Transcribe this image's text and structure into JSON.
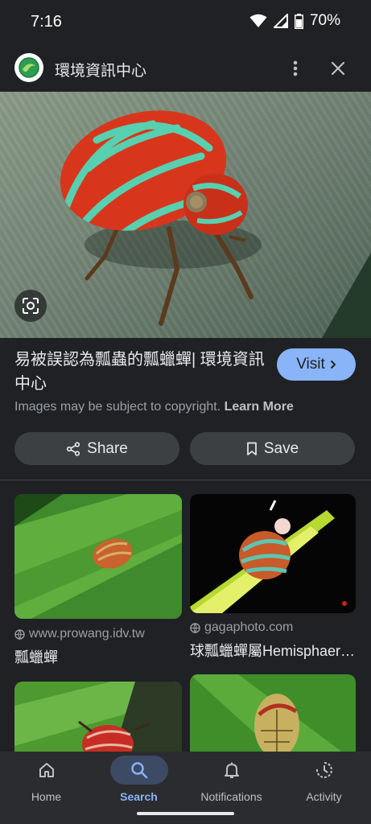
{
  "status_bar": {
    "time": "7:16",
    "battery": "70%"
  },
  "header": {
    "site_name": "環境資訊中心",
    "icons": [
      "more-vert-icon",
      "close-icon"
    ]
  },
  "result": {
    "title": "易被誤認為瓢蟲的瓢蠟蟬| 環境資訊中心",
    "visit_label": "Visit",
    "copyright_text": "Images may be subject to copyright.",
    "learn_more_label": "Learn More",
    "share_label": "Share",
    "save_label": "Save"
  },
  "related": [
    {
      "source": "www.prowang.idv.tw",
      "title": "瓢蠟蟬"
    },
    {
      "source": "gagaphoto.com",
      "title": "球瓢蠟蟬屬Hemisphaerius"
    },
    {
      "source": "",
      "title": ""
    },
    {
      "source": "",
      "title": ""
    }
  ],
  "bottom_nav": [
    {
      "label": "Home",
      "icon": "home-icon",
      "active": false
    },
    {
      "label": "Search",
      "icon": "search-icon",
      "active": true
    },
    {
      "label": "Notifications",
      "icon": "bell-icon",
      "active": false
    },
    {
      "label": "Activity",
      "icon": "history-icon",
      "active": false
    }
  ],
  "colors": {
    "background": "#202124",
    "accent": "#8ab4f8",
    "button": "#3c4043"
  }
}
